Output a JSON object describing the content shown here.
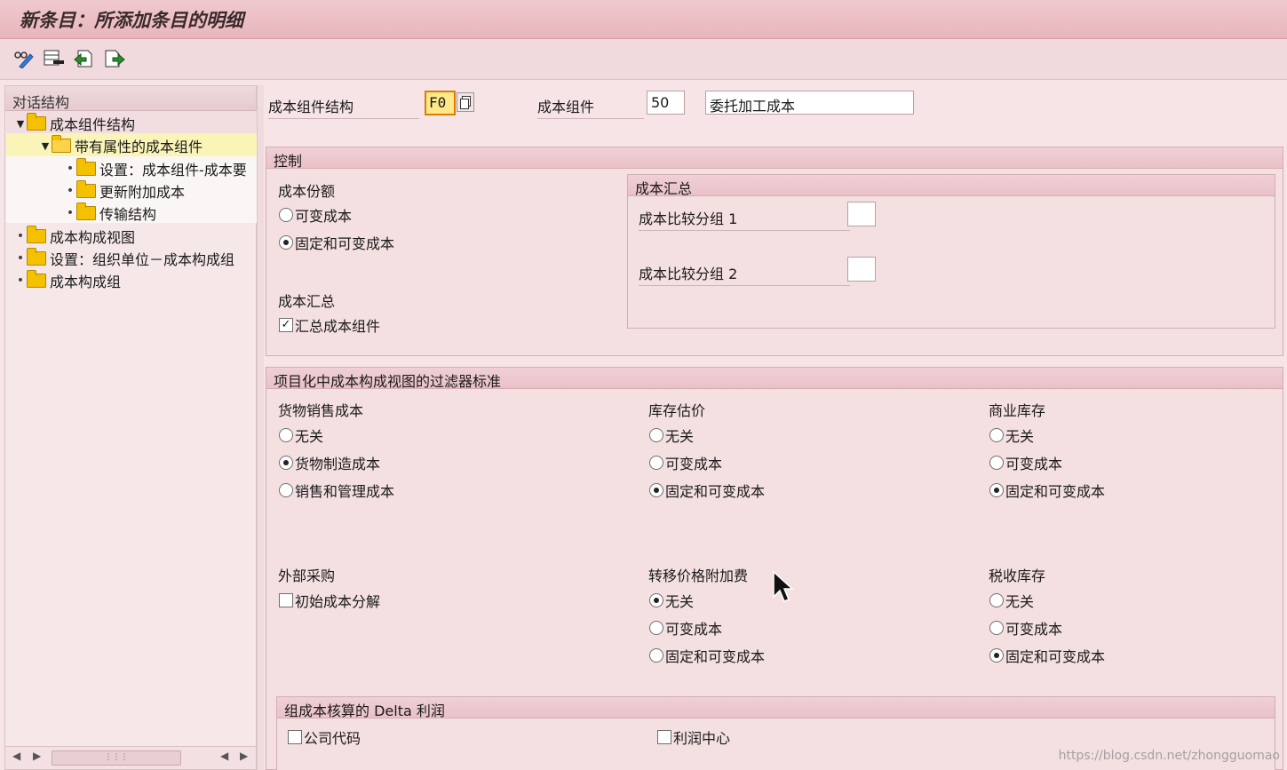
{
  "window": {
    "title": "新条目：所添加条目的明细"
  },
  "toolbar": {
    "buttons": [
      {
        "icon": "display-change-icon"
      },
      {
        "icon": "delete-row-icon"
      },
      {
        "icon": "previous-entry-icon"
      },
      {
        "icon": "next-entry-icon"
      }
    ]
  },
  "tree": {
    "header": "对话结构",
    "nodes": [
      {
        "label": "成本组件结构"
      },
      {
        "label": "带有属性的成本组件"
      },
      {
        "label": "设置：成本组件-成本要"
      },
      {
        "label": "更新附加成本"
      },
      {
        "label": "传输结构"
      },
      {
        "label": "成本构成视图"
      },
      {
        "label": "设置：组织单位－成本构成组"
      },
      {
        "label": "成本构成组"
      }
    ]
  },
  "header_fields": {
    "structure_label": "成本组件结构",
    "structure_value": "F0",
    "component_label": "成本组件",
    "component_value": "50",
    "component_desc": "委托加工成本"
  },
  "control": {
    "title": "控制",
    "cost_share": {
      "title": "成本份额",
      "options": [
        {
          "label": "可变成本",
          "selected": false
        },
        {
          "label": "固定和可变成本",
          "selected": true
        }
      ]
    },
    "cost_rollup": {
      "title": "成本汇总",
      "checkbox_label": "汇总成本组件",
      "checked": true
    },
    "summary_box": {
      "title": "成本汇总",
      "group1_label": "成本比较分组 1",
      "group1_value": "",
      "group2_label": "成本比较分组 2",
      "group2_value": ""
    }
  },
  "filter": {
    "title": "项目化中成本构成视图的过滤器标准",
    "cogs": {
      "title": "货物销售成本",
      "options": [
        {
          "label": "无关",
          "selected": false
        },
        {
          "label": "货物制造成本",
          "selected": true
        },
        {
          "label": "销售和管理成本",
          "selected": false
        }
      ]
    },
    "inventory": {
      "title": "库存估价",
      "options": [
        {
          "label": "无关",
          "selected": false
        },
        {
          "label": "可变成本",
          "selected": false
        },
        {
          "label": "固定和可变成本",
          "selected": true
        }
      ]
    },
    "commercial": {
      "title": "商业库存",
      "options": [
        {
          "label": "无关",
          "selected": false
        },
        {
          "label": "可变成本",
          "selected": false
        },
        {
          "label": "固定和可变成本",
          "selected": true
        }
      ]
    },
    "external": {
      "title": "外部采购",
      "checkbox_label": "初始成本分解",
      "checked": false
    },
    "transfer": {
      "title": "转移价格附加费",
      "options": [
        {
          "label": "无关",
          "selected": true
        },
        {
          "label": "可变成本",
          "selected": false
        },
        {
          "label": "固定和可变成本",
          "selected": false
        }
      ]
    },
    "tax": {
      "title": "税收库存",
      "options": [
        {
          "label": "无关",
          "selected": false
        },
        {
          "label": "可变成本",
          "selected": false
        },
        {
          "label": "固定和可变成本",
          "selected": true
        }
      ]
    }
  },
  "delta": {
    "title": "组成本核算的 Delta 利润",
    "company_code_label": "公司代码",
    "company_code_checked": false,
    "profit_center_label": "利润中心",
    "profit_center_checked": false
  },
  "watermark": "https://blog.csdn.net/zhongguomao"
}
